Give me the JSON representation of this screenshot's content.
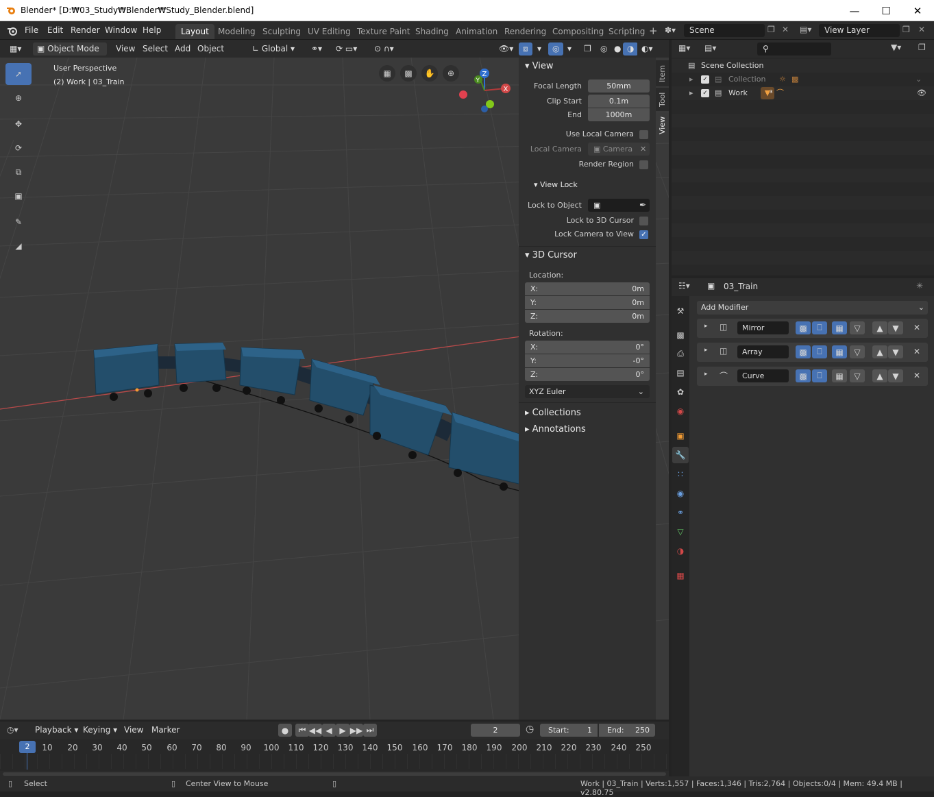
{
  "window": {
    "title": "Blender* [D:₩03_Study₩Blender₩Study_Blender.blend]"
  },
  "menus": [
    "File",
    "Edit",
    "Render",
    "Window",
    "Help"
  ],
  "workspaces": [
    "Layout",
    "Modeling",
    "Sculpting",
    "UV Editing",
    "Texture Paint",
    "Shading",
    "Animation",
    "Rendering",
    "Compositing",
    "Scripting"
  ],
  "scene": {
    "name": "Scene",
    "view_layer": "View Layer"
  },
  "viewport_header": {
    "mode": "Object Mode",
    "view": "View",
    "select": "Select",
    "add": "Add",
    "object": "Object",
    "orientation": "Global"
  },
  "viewport": {
    "perspective": "User Perspective",
    "context": "(2) Work | 03_Train"
  },
  "npanel": {
    "tabs": [
      "Item",
      "Tool",
      "View"
    ],
    "view": {
      "title": "View",
      "focal_length_label": "Focal Length",
      "focal_length": "50mm",
      "clip_start_label": "Clip Start",
      "clip_start": "0.1m",
      "end_label": "End",
      "end": "1000m",
      "use_local_camera": "Use Local Camera",
      "local_camera_label": "Local Camera",
      "local_camera": "Camera",
      "render_region": "Render Region"
    },
    "view_lock": {
      "title": "View Lock",
      "lock_to_object": "Lock to Object",
      "lock_to_3d_cursor": "Lock to 3D Cursor",
      "lock_camera_to_view": "Lock Camera to View"
    },
    "cursor": {
      "title": "3D Cursor",
      "location_label": "Location:",
      "x_label": "X:",
      "x": "0m",
      "y_label": "Y:",
      "y": "0m",
      "z_label": "Z:",
      "z": "0m",
      "rotation_label": "Rotation:",
      "rx_label": "X:",
      "rx": "0°",
      "ry_label": "Y:",
      "ry": "-0°",
      "rz_label": "Z:",
      "rz": "0°",
      "rotation_mode": "XYZ Euler"
    },
    "collections": "Collections",
    "annotations": "Annotations"
  },
  "outliner": {
    "root": "Scene Collection",
    "items": [
      {
        "label": "Collection"
      },
      {
        "label": "Work"
      }
    ],
    "work_badge": "3"
  },
  "properties": {
    "object_name": "03_Train",
    "add_modifier": "Add Modifier",
    "modifiers": [
      {
        "name": "Mirror"
      },
      {
        "name": "Array"
      },
      {
        "name": "Curve"
      }
    ]
  },
  "timeline": {
    "playback": "Playback",
    "keying": "Keying",
    "view": "View",
    "marker": "Marker",
    "current_frame": "2",
    "start_label": "Start:",
    "start": "1",
    "end_label": "End:",
    "end": "250",
    "ruler": [
      "10",
      "20",
      "30",
      "40",
      "50",
      "60",
      "70",
      "80",
      "90",
      "100",
      "110",
      "120",
      "130",
      "140",
      "150",
      "160",
      "170",
      "180",
      "190",
      "200",
      "210",
      "220",
      "230",
      "240",
      "250"
    ],
    "playhead": "2"
  },
  "statusbar": {
    "select": "Select",
    "center_view": "Center View to Mouse",
    "stats": "Work | 03_Train | Verts:1,557 | Faces:1,346 | Tris:2,764 | Objects:0/4 | Mem: 49.4 MB | v2.80.75"
  }
}
